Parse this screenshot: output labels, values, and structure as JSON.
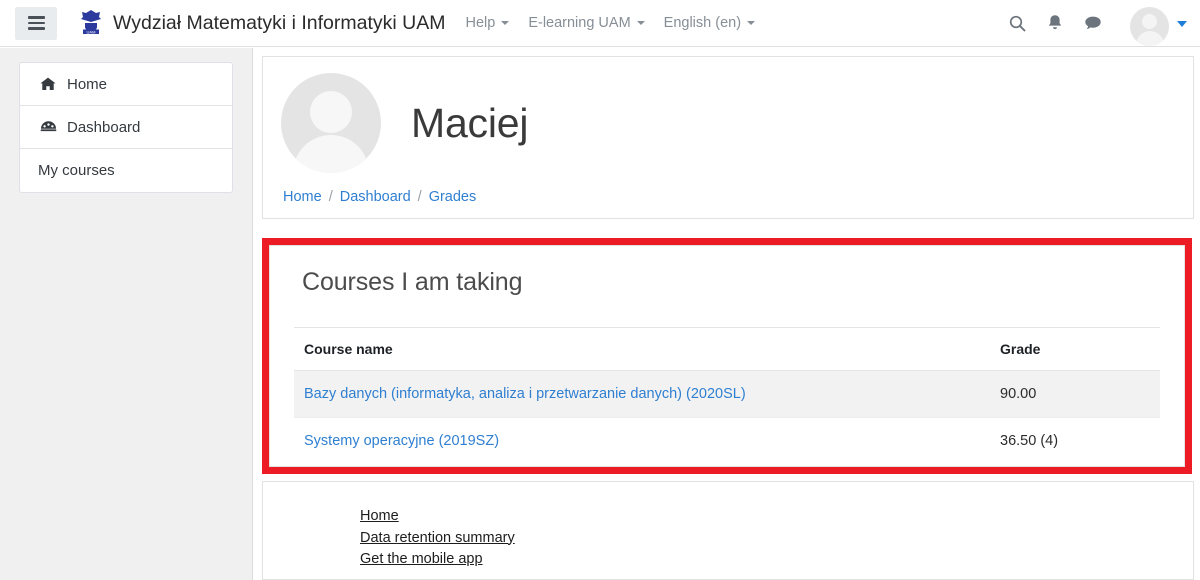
{
  "navbar": {
    "menu_button": "hamburger-menu",
    "brand_title": "Wydział Matematyki i Informatyki UAM",
    "logo_alt": "UAM",
    "links": [
      {
        "label": "Help",
        "has_caret": true
      },
      {
        "label": "E-learning UAM",
        "has_caret": true
      },
      {
        "label": "English (en)",
        "has_caret": true
      }
    ],
    "icons": [
      "search-icon",
      "notification-bell-icon",
      "messages-icon"
    ],
    "avatar": "user-avatar"
  },
  "sidebar": {
    "items": [
      {
        "label": "Home",
        "icon": "home-icon"
      },
      {
        "label": "Dashboard",
        "icon": "dashboard-icon"
      },
      {
        "label": "My courses",
        "icon": ""
      }
    ]
  },
  "profile": {
    "name": "Maciej",
    "avatar": "user-avatar-placeholder"
  },
  "breadcrumb": {
    "items": [
      "Home",
      "Dashboard",
      "Grades"
    ],
    "separator": "/"
  },
  "grades": {
    "title": "Courses I am taking",
    "columns": [
      "Course name",
      "Grade"
    ],
    "rows": [
      {
        "course": "Bazy danych (informatyka, analiza i przetwarzanie danych) (2020SL)",
        "grade": "90.00"
      },
      {
        "course": "Systemy operacyjne (2019SZ)",
        "grade": "36.50 (4)"
      }
    ],
    "highlight_color": "#ed1c24"
  },
  "footer": {
    "links": [
      "Home",
      "Data retention summary",
      "Get the mobile app"
    ]
  }
}
